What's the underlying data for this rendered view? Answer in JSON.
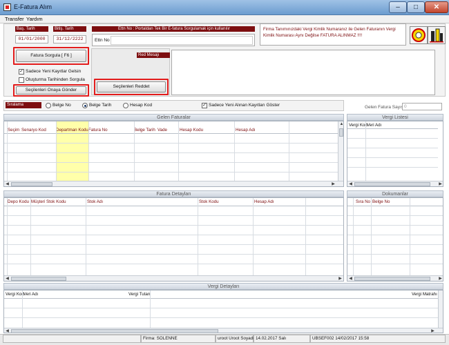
{
  "window": {
    "title": "E-Fatura Alım",
    "min_glyph": "–",
    "max_glyph": "□",
    "close_glyph": "✕"
  },
  "menu": [
    "Transfer",
    "Yardım"
  ],
  "dates": {
    "start_label": "Baş. Tarih",
    "start_value": "01/01/2000",
    "end_label": "Bitiş. Tarih",
    "end_value": "31/12/2222"
  },
  "ettn": {
    "header": "Ettn No : Portaldan Tek Bir E-fatura Sorgulamak için kullanılır",
    "label": "Ettn No :",
    "value": ""
  },
  "warning": "Firma Tanımınızdaki Vergi Kimlik Numaranız ile Gelen Faturanın Vergi Kimlik Numarası Aynı Değilse FATURA ALINMAZ !!!!",
  "buttons": {
    "query": "Fatura Sorgula [ F6 ]",
    "approve": "Seçilenleri Onaya Gönder",
    "reject": "Seçilenleri Reddet"
  },
  "checkboxes": {
    "only_new": "Sadece Yeni Kayıtlar Gelsin",
    "only_new_checked": true,
    "by_creation": "Oluşturma Tarihinden Sorgula",
    "by_creation_checked": false,
    "only_new_show": "Sadece Yeni Alınan Kayıtları Göster",
    "only_new_show_checked": true
  },
  "reject_message_label": "Red Mesajı",
  "sort": {
    "label": "Sıralama",
    "options": [
      "Belge No",
      "Belge Tarih",
      "Hesap Kod"
    ],
    "selected": "Belge Tarih"
  },
  "incoming_count": {
    "label": "Gelen Fatura Sayısı :",
    "value": "0"
  },
  "sections": {
    "incoming": "Gelen Faturalar",
    "tax_list": "Vergi Listesi",
    "details": "Fatura Detayları",
    "documents": "Dokumanlar",
    "tax_details": "Vergi Detayları"
  },
  "incoming_columns": [
    "Seçim",
    "Senaryo Kod",
    "Departman Kodu",
    "Fatura No",
    "Belge Tarih",
    "Vade",
    "Hesap Kodu",
    "Hesap Adı"
  ],
  "tax_list_columns": [
    "Vergi Kod",
    "Veri Adı"
  ],
  "detail_columns": [
    "Depo Kodu",
    "Müşteri Stok Kodu",
    "Stok Adı",
    "Stok Kodu",
    "Hesap Adı"
  ],
  "document_columns": [
    "Sıra No",
    "Belge No"
  ],
  "tax_detail_columns": [
    "Vergi Kod",
    "Veri Adı",
    "Vergi Tutarı",
    "Vergi Matrahı"
  ],
  "status": {
    "firm": "Firma: SOLENNE",
    "user": "uroot Uroot Soyadı",
    "date": "14.02.2017  Salı",
    "code": "UBSEF002 14/02/2017 15:58"
  },
  "colors": {
    "accent": "#7d0e10",
    "highlight_red": "#e21b1b",
    "selected_column": "#ffffaa"
  },
  "icons": [
    "window-app-icon",
    "document-logo-icon",
    "building-logo-icon",
    "checkmark-icon",
    "scroll-arrow-icon"
  ]
}
